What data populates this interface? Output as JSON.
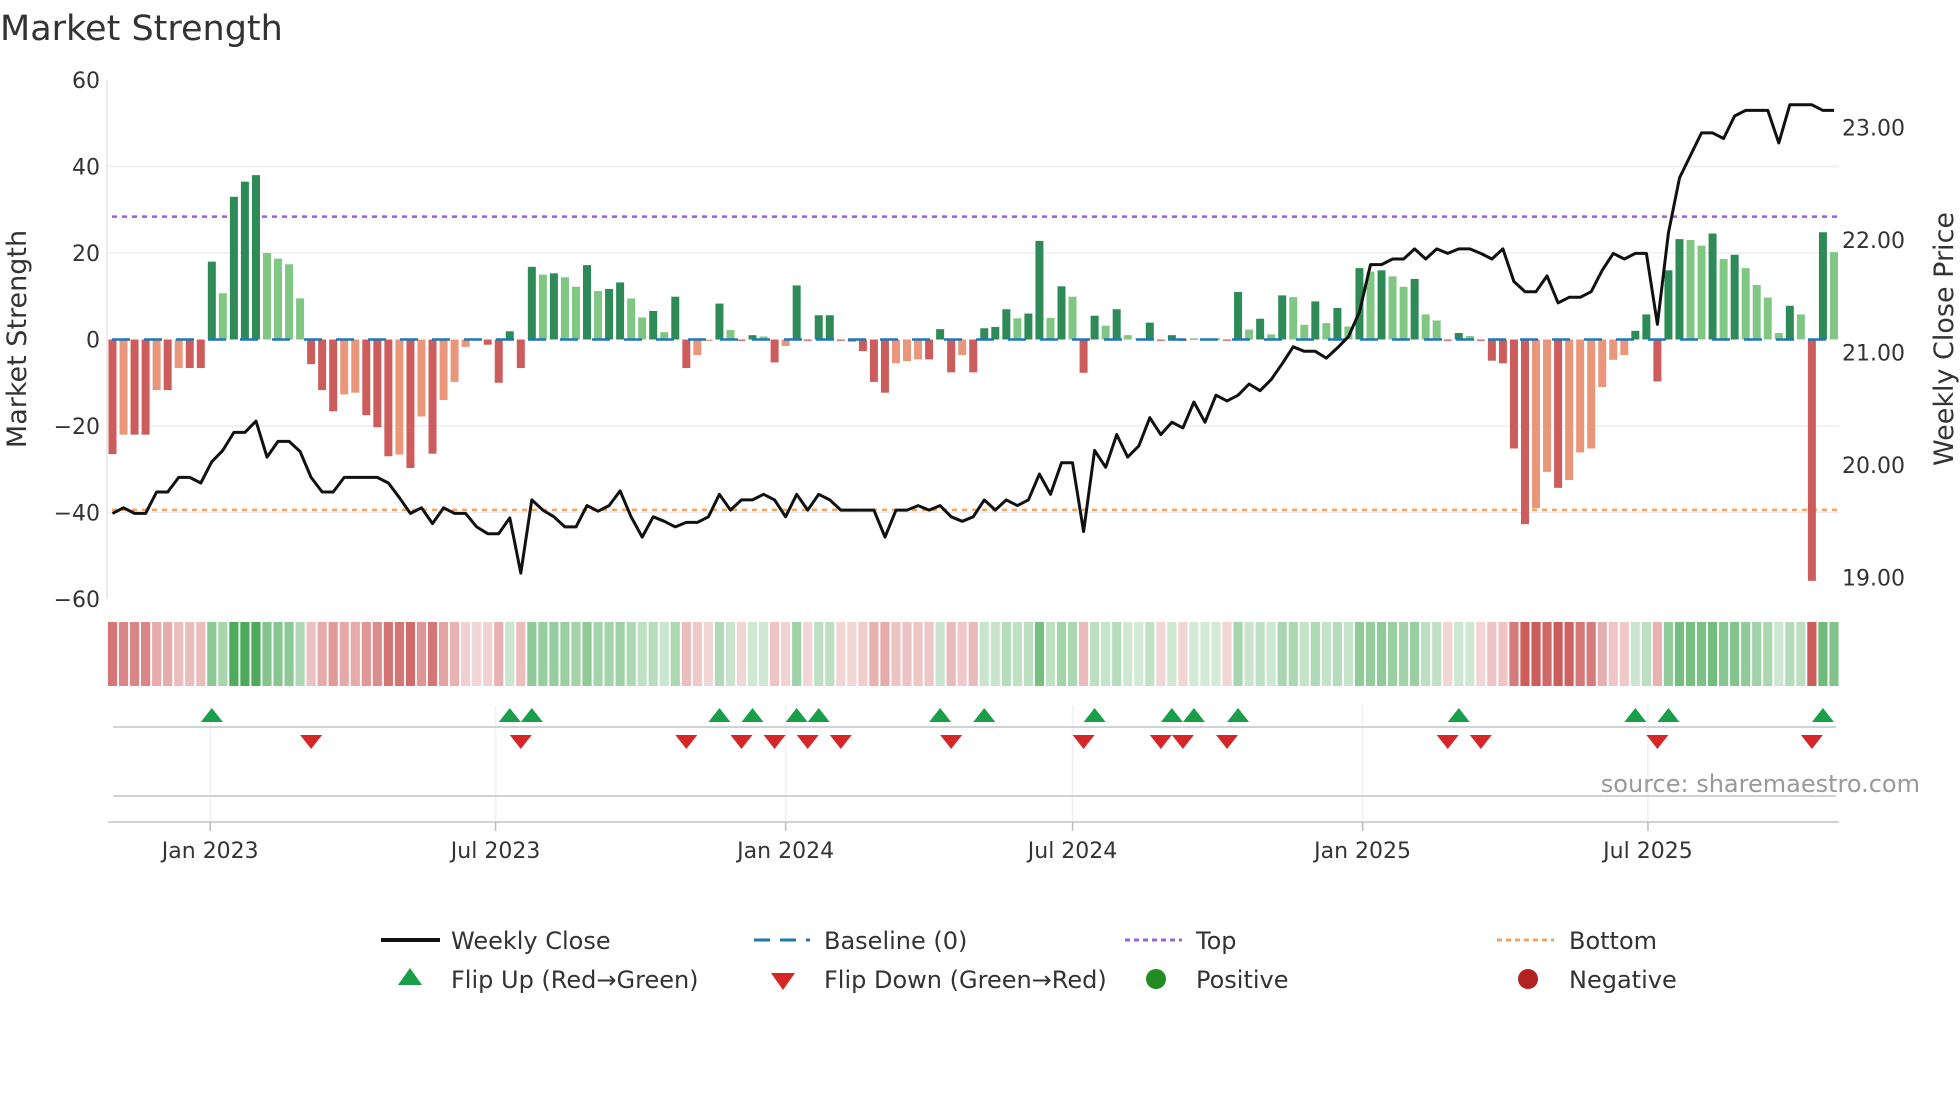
{
  "chart_data": {
    "type": "bar",
    "title": "Market Strength",
    "ylabel": "Market Strength",
    "y2label": "Weekly Close Price",
    "ylim": [
      -60,
      60
    ],
    "y2lim": [
      18.81,
      23.42
    ],
    "yticks": [
      60,
      40,
      20,
      0,
      -20,
      -40,
      -60
    ],
    "yticks_labels": [
      "60",
      "40",
      "20",
      "0",
      "−20",
      "−40",
      "−60"
    ],
    "y2ticks": [
      23,
      22,
      21,
      20,
      19
    ],
    "y2ticks_labels": [
      "23.00",
      "22.00",
      "21.00",
      "20.00",
      "19.00"
    ],
    "x_start": "2022-10-31",
    "x_step_days": 7,
    "xticks": [
      {
        "date": "2023-01-01",
        "label": "Jan 2023"
      },
      {
        "date": "2023-07-01",
        "label": "Jul 2023"
      },
      {
        "date": "2024-01-01",
        "label": "Jan 2024"
      },
      {
        "date": "2024-07-01",
        "label": "Jul 2024"
      },
      {
        "date": "2025-01-01",
        "label": "Jan 2025"
      },
      {
        "date": "2025-07-01",
        "label": "Jul 2025"
      }
    ],
    "top_level": 28.4,
    "bottom_level": -39.4,
    "grid": true,
    "legend_placement": "bottom",
    "strength": [
      -26.5,
      -22,
      -22,
      -22,
      -11.7,
      -11.7,
      -6.6,
      -6.6,
      -6.6,
      18,
      10.7,
      33,
      36.5,
      38,
      20,
      18.7,
      17.4,
      9.5,
      -5.7,
      -11.7,
      -16.6,
      -12.7,
      -12.3,
      -17.5,
      -20.3,
      -27,
      -26.6,
      -29.7,
      -17.8,
      -26.4,
      -14,
      -9.8,
      -1.7,
      -0.2,
      -1.2,
      -10,
      1.9,
      -6.6,
      16.8,
      15,
      15.3,
      14.4,
      12.2,
      17.2,
      11.2,
      11.7,
      13.2,
      9.5,
      5.1,
      6.6,
      1.7,
      9.9,
      -6.6,
      -3.6,
      -0.3,
      8.3,
      2.2,
      -0.3,
      1,
      0.7,
      -5.3,
      -1.5,
      12.5,
      -0.3,
      5.6,
      5.6,
      -0.3,
      -0.5,
      -2.7,
      -9.8,
      -12.3,
      -5.5,
      -5,
      -4.6,
      -4.6,
      2.4,
      -7.6,
      -3.6,
      -7.6,
      2.6,
      2.9,
      7,
      4.9,
      6,
      22.8,
      5,
      12.3,
      9.9,
      -7.7,
      5.5,
      3.2,
      7,
      1,
      0.2,
      3.9,
      -0.3,
      1,
      -0.3,
      0.2,
      0.2,
      0.2,
      -0.3,
      11,
      2.3,
      4.8,
      1.2,
      10.2,
      9.8,
      3.4,
      8.8,
      3.8,
      7.3,
      3,
      16.5,
      15.7,
      16,
      14.6,
      12.2,
      14,
      5.8,
      4.4,
      -0.3,
      1.5,
      0.8,
      -0.3,
      -4.9,
      -5.5,
      -25.2,
      -42.7,
      -39,
      -30.6,
      -34.3,
      -32.5,
      -26.1,
      -25.2,
      -11,
      -4.7,
      -3.6,
      2,
      5.8,
      -9.7,
      16,
      23.2,
      23,
      21.7,
      24.5,
      18.6,
      19.6,
      16.5,
      12.6,
      9.7,
      1.5,
      7.8,
      5.8,
      -55.8,
      24.8,
      20.2
    ],
    "weekly_close": [
      19.57,
      19.62,
      19.57,
      19.57,
      19.76,
      19.76,
      19.89,
      19.89,
      19.84,
      20.03,
      20.13,
      20.29,
      20.29,
      20.39,
      20.07,
      20.21,
      20.21,
      20.12,
      19.89,
      19.76,
      19.76,
      19.89,
      19.89,
      19.89,
      19.89,
      19.84,
      19.71,
      19.57,
      19.62,
      19.48,
      19.62,
      19.57,
      19.57,
      19.45,
      19.39,
      19.39,
      19.53,
      19.04,
      19.69,
      19.6,
      19.54,
      19.45,
      19.45,
      19.64,
      19.59,
      19.64,
      19.77,
      19.54,
      19.36,
      19.54,
      19.5,
      19.45,
      19.49,
      19.49,
      19.54,
      19.74,
      19.6,
      19.69,
      19.69,
      19.74,
      19.69,
      19.54,
      19.74,
      19.6,
      19.74,
      19.69,
      19.6,
      19.6,
      19.6,
      19.6,
      19.36,
      19.6,
      19.6,
      19.64,
      19.6,
      19.64,
      19.54,
      19.5,
      19.54,
      19.69,
      19.6,
      19.69,
      19.64,
      19.69,
      19.92,
      19.74,
      20.02,
      20.02,
      19.41,
      20.13,
      19.98,
      20.27,
      20.07,
      20.17,
      20.42,
      20.27,
      20.38,
      20.33,
      20.56,
      20.38,
      20.62,
      20.57,
      20.62,
      20.72,
      20.66,
      20.76,
      20.9,
      21.05,
      21.01,
      21.01,
      20.95,
      21.04,
      21.14,
      21.36,
      21.78,
      21.78,
      21.83,
      21.83,
      21.92,
      21.83,
      21.92,
      21.88,
      21.92,
      21.92,
      21.88,
      21.83,
      21.92,
      21.63,
      21.54,
      21.54,
      21.68,
      21.44,
      21.49,
      21.49,
      21.54,
      21.73,
      21.88,
      21.83,
      21.88,
      21.88,
      21.25,
      22.06,
      22.55,
      22.75,
      22.95,
      22.95,
      22.9,
      23.1,
      23.15,
      23.15,
      23.15,
      22.86,
      23.2,
      23.2,
      23.2,
      23.15,
      23.15
    ],
    "legend": [
      {
        "key": "weekly_close",
        "label": "Weekly Close"
      },
      {
        "key": "baseline",
        "label": "Baseline (0)"
      },
      {
        "key": "top",
        "label": "Top"
      },
      {
        "key": "bottom",
        "label": "Bottom"
      },
      {
        "key": "flip_up",
        "label": "Flip Up (Red→Green)"
      },
      {
        "key": "flip_down",
        "label": "Flip Down (Green→Red)"
      },
      {
        "key": "positive",
        "label": "Positive"
      },
      {
        "key": "negative",
        "label": "Negative"
      }
    ],
    "source": "source: sharemaestro.com"
  },
  "colors": {
    "pos_strong": "#2e8b57",
    "pos_weak": "#81c784",
    "neg_strong": "#cd5c5c",
    "neg_weak": "#e9967a",
    "line": "#111111",
    "baseline": "#1f77b4",
    "top": "#9d5fe0",
    "bottom": "#f4a460",
    "flip_up": "#1a9e4a",
    "flip_down": "#d62728",
    "positive": "#228b22",
    "negative": "#b22222",
    "grid": "#eeeeee",
    "axis": "#cccccc"
  }
}
